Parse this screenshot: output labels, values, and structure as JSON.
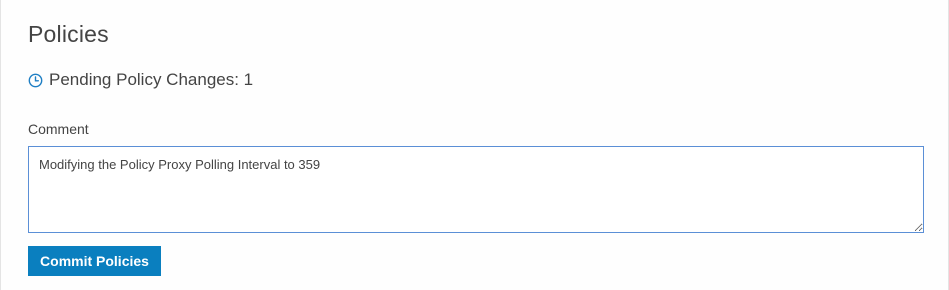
{
  "page": {
    "title": "Policies"
  },
  "pending": {
    "icon": "clock-icon",
    "label": "Pending Policy Changes: 1",
    "icon_color": "#1f7fc4"
  },
  "comment": {
    "label": "Comment",
    "value": "Modifying the Policy Proxy Polling Interval to 359"
  },
  "actions": {
    "commit_label": "Commit Policies",
    "commit_color": "#0a7fbf"
  },
  "colors": {
    "text": "#444444",
    "input_border_focus": "#5b8fd6"
  }
}
